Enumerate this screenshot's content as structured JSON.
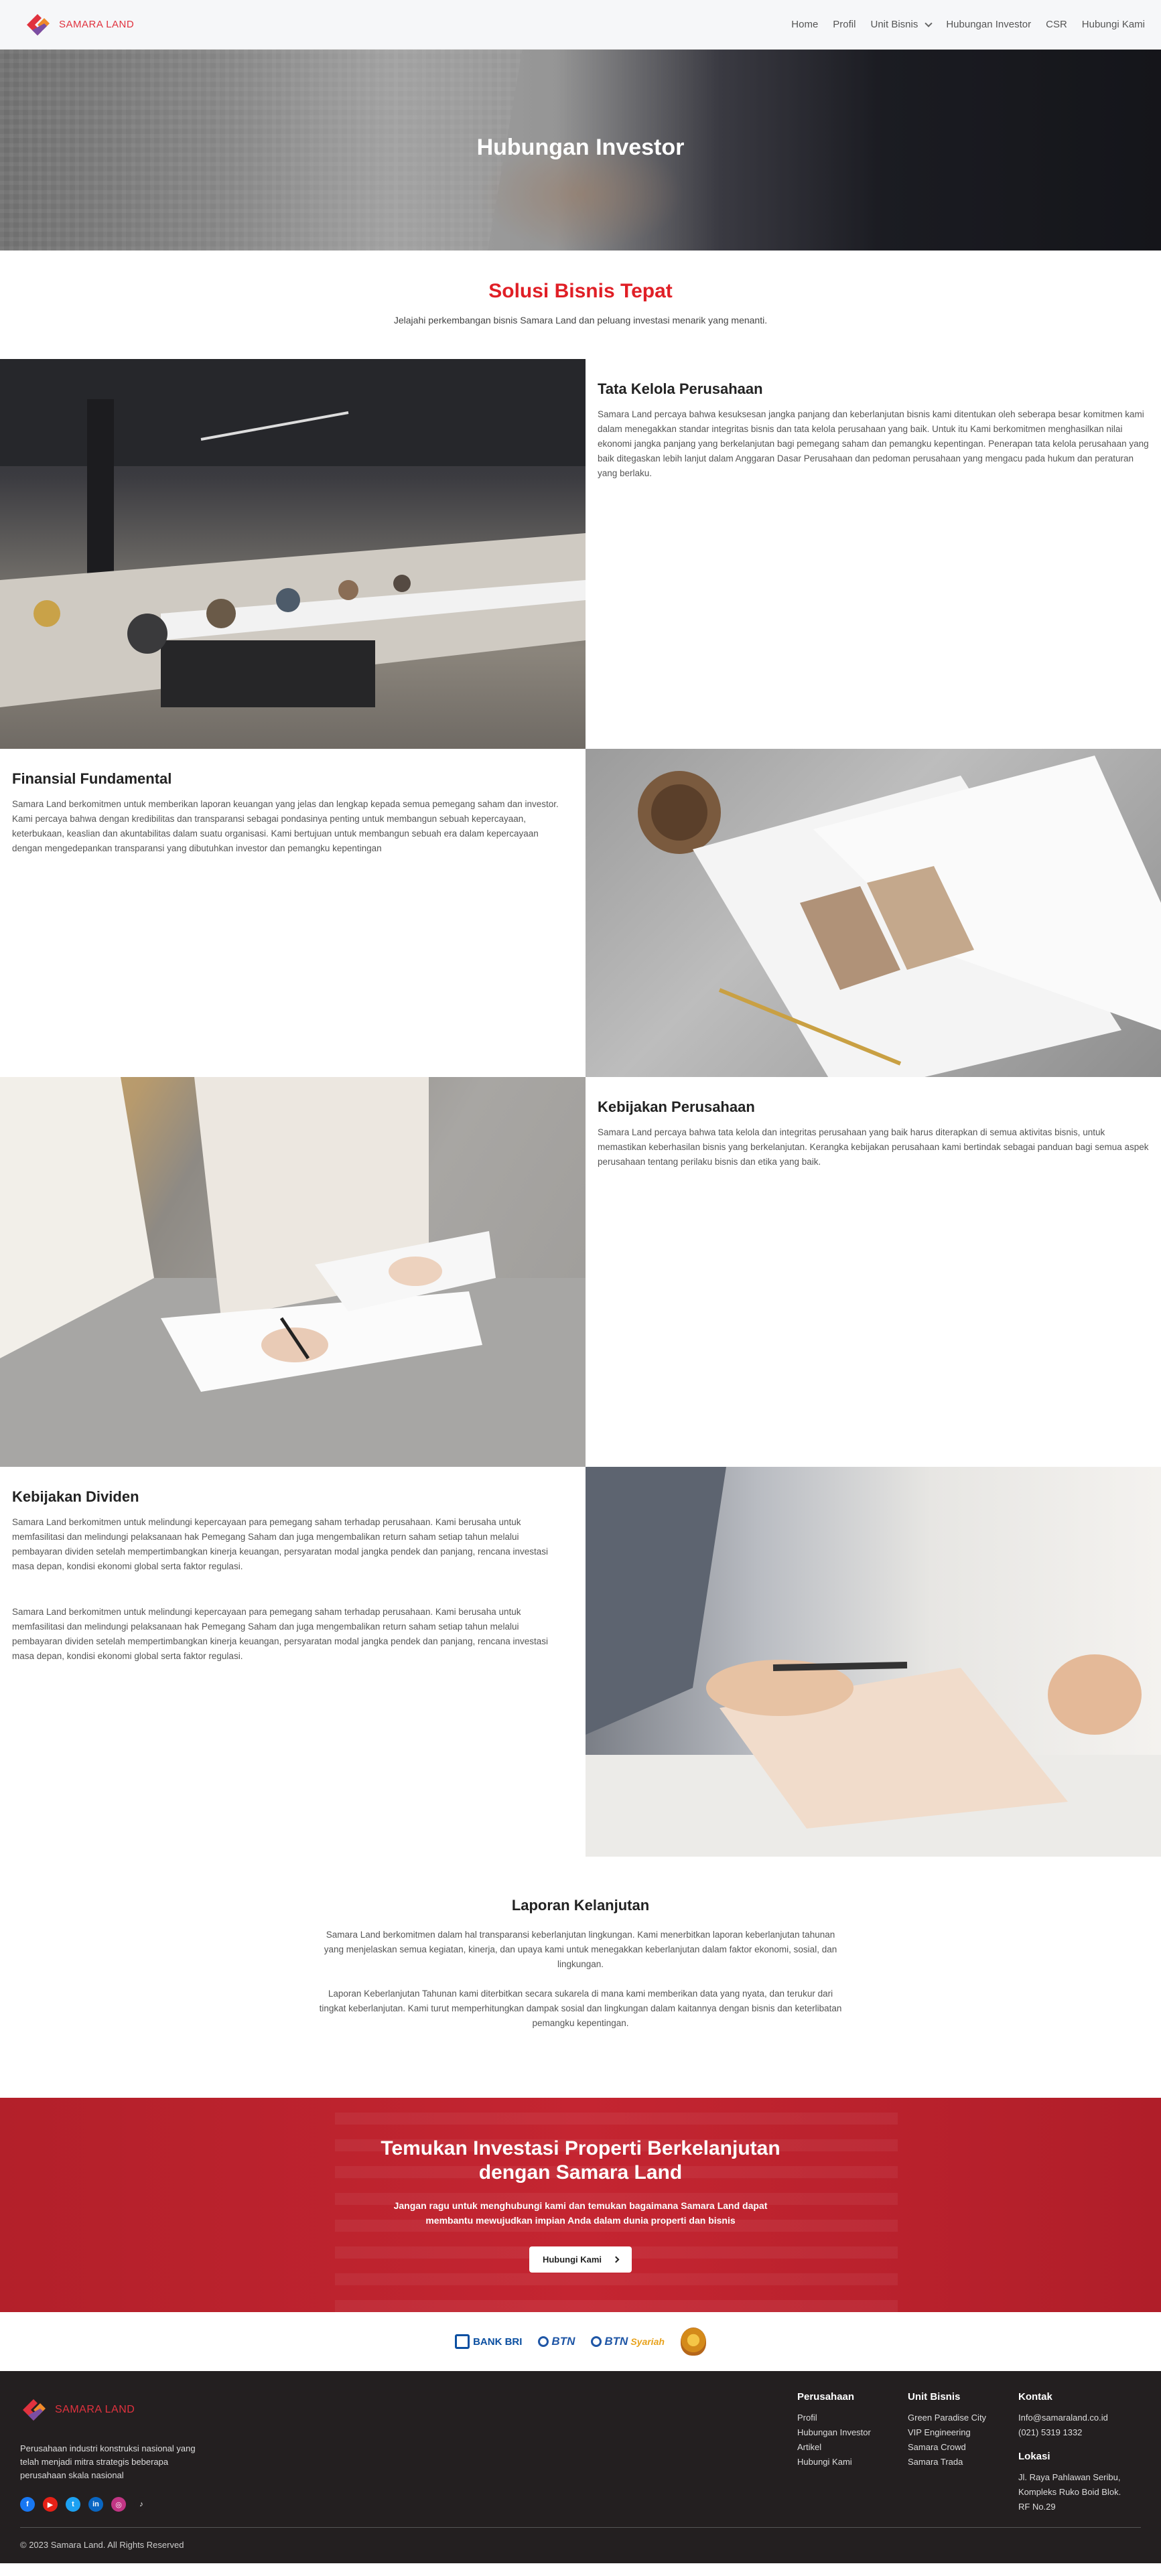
{
  "brand": {
    "name_part1": "SAMARA",
    "name_part2": " LAND"
  },
  "nav": {
    "items": [
      "Home",
      "Profil",
      "Unit Bisnis",
      "Hubungan Investor",
      "CSR",
      "Hubungi Kami"
    ]
  },
  "hero": {
    "title": "Hubungan Investor"
  },
  "intro": {
    "title": "Solusi Bisnis Tepat",
    "subtitle": "Jelajahi perkembangan bisnis Samara Land dan peluang investasi menarik yang menanti."
  },
  "sections": [
    {
      "title": "Tata Kelola Perusahaan",
      "body": "Samara Land percaya bahwa kesuksesan jangka panjang dan keberlanjutan bisnis kami ditentukan oleh seberapa besar komitmen kami dalam menegakkan standar integritas bisnis dan tata kelola perusahaan yang baik. Untuk itu Kami berkomitmen menghasilkan nilai ekonomi jangka panjang yang berkelanjutan bagi pemegang saham dan pemangku kepentingan. Penerapan tata kelola perusahaan yang baik ditegaskan lebih lanjut dalam Anggaran Dasar Perusahaan dan pedoman perusahaan yang mengacu pada hukum dan peraturan yang berlaku."
    },
    {
      "title": "Finansial Fundamental",
      "body": "Samara Land berkomitmen untuk memberikan laporan keuangan yang jelas dan lengkap kepada semua pemegang saham dan investor. Kami percaya bahwa dengan kredibilitas dan transparansi sebagai pondasinya penting untuk membangun sebuah kepercayaan, keterbukaan, keaslian dan akuntabilitas dalam suatu organisasi. Kami bertujuan untuk membangun sebuah era dalam kepercayaan dengan mengedepankan transparansi yang dibutuhkan investor dan pemangku kepentingan"
    },
    {
      "title": "Kebijakan Perusahaan",
      "body": "Samara Land percaya bahwa tata kelola dan integritas perusahaan yang baik harus diterapkan di semua aktivitas bisnis, untuk memastikan keberhasilan bisnis yang berkelanjutan. Kerangka kebijakan perusahaan kami bertindak sebagai panduan bagi semua aspek perusahaan tentang perilaku bisnis dan etika yang baik."
    },
    {
      "title": "Kebijakan Dividen",
      "body": "Samara Land berkomitmen untuk melindungi kepercayaan para pemegang saham terhadap perusahaan. Kami berusaha untuk memfasilitasi dan melindungi pelaksanaan hak Pemegang Saham dan juga mengembalikan return saham setiap tahun melalui pembayaran dividen setelah mempertimbangkan kinerja keuangan, persyaratan modal jangka pendek dan panjang, rencana investasi masa depan, kondisi ekonomi global serta faktor regulasi.",
      "body2": "Samara Land berkomitmen untuk melindungi kepercayaan para pemegang saham terhadap perusahaan. Kami berusaha untuk memfasilitasi dan melindungi pelaksanaan hak Pemegang Saham dan juga mengembalikan return saham setiap tahun melalui pembayaran dividen setelah mempertimbangkan kinerja keuangan, persyaratan modal jangka pendek dan panjang, rencana investasi masa depan, kondisi ekonomi global serta faktor regulasi."
    }
  ],
  "laporan": {
    "title": "Laporan Kelanjutan",
    "p1": "Samara Land berkomitmen dalam hal transparansi keberlanjutan lingkungan. Kami menerbitkan laporan keberlanjutan tahunan yang menjelaskan semua kegiatan, kinerja, dan upaya kami untuk menegakkan keberlanjutan dalam faktor ekonomi, sosial, dan lingkungan.",
    "p2": "Laporan Keberlanjutan Tahunan kami diterbitkan secara sukarela di mana kami memberikan data yang nyata, dan terukur dari tingkat keberlanjutan. Kami turut memperhitungkan dampak sosial dan lingkungan dalam kaitannya dengan bisnis dan keterlibatan pemangku kepentingan."
  },
  "cta": {
    "title_line1": "Temukan Investasi Properti Berkelanjutan",
    "title_line2": "dengan Samara Land",
    "body": "Jangan ragu untuk menghubungi kami dan temukan bagaimana Samara Land dapat membantu mewujudkan impian Anda dalam dunia properti dan bisnis",
    "button": "Hubungi Kami"
  },
  "partners": {
    "bri": "BANK BRI",
    "btn": "BTN",
    "btn2": "BTN",
    "syariah": "Syariah"
  },
  "footer": {
    "tagline": "Perusahaan industri konstruksi nasional yang telah menjadi mitra strategis beberapa perusahaan skala nasional",
    "socials": [
      "facebook-icon",
      "youtube-icon",
      "twitter-icon",
      "linkedin-icon",
      "instagram-icon",
      "tiktok-icon"
    ],
    "perusahaan": {
      "title": "Perusahaan",
      "items": [
        "Profil",
        "Hubungan Investor",
        "Artikel",
        "Hubungi Kami"
      ]
    },
    "unit": {
      "title": "Unit Bisnis",
      "items": [
        "Green Paradise City",
        "VIP Engineering",
        "Samara Crowd",
        "Samara Trada"
      ]
    },
    "kontak": {
      "title": "Kontak",
      "email": "Info@samaraland.co.id",
      "phone": "(021) 5319 1332"
    },
    "lokasi": {
      "title": "Lokasi",
      "address": "Jl. Raya Pahlawan Seribu, Kompleks Ruko Boid Blok. RF No.29"
    },
    "copyright": "© 2023 Samara Land. All Rights Reserved"
  },
  "colors": {
    "accent": "#e01f26",
    "cta_bg": "#c42531",
    "footer_bg": "#231f20"
  }
}
